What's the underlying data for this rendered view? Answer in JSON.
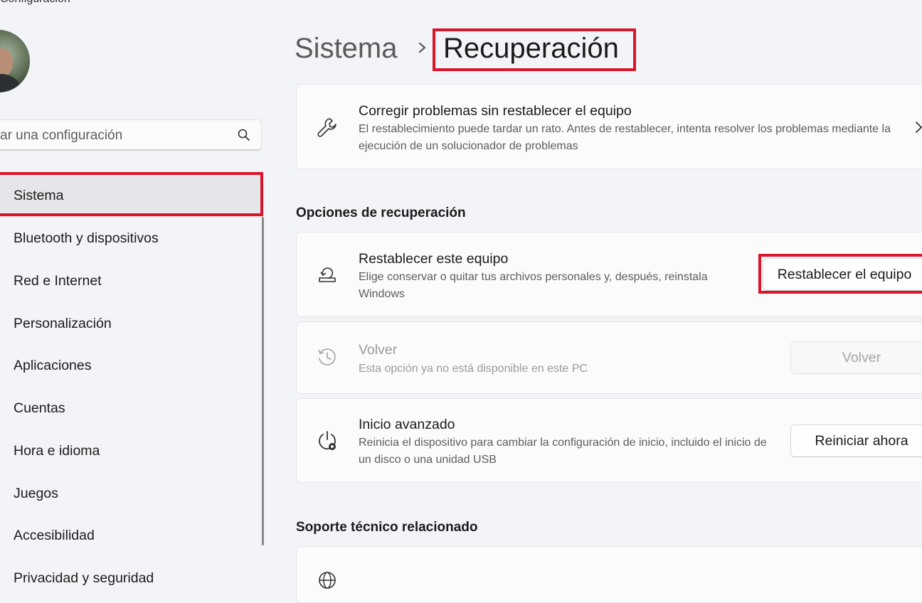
{
  "window": {
    "app_title": "Configuración"
  },
  "search": {
    "placeholder": "Buscar una configuración",
    "visible_text": "scar una configuración",
    "icon": "search-icon"
  },
  "sidebar": {
    "items": [
      {
        "label": "Sistema",
        "active": true
      },
      {
        "label": "Bluetooth y dispositivos"
      },
      {
        "label": "Red e Internet"
      },
      {
        "label": "Personalización"
      },
      {
        "label": "Aplicaciones"
      },
      {
        "label": "Cuentas"
      },
      {
        "label": "Hora e idioma"
      },
      {
        "label": "Juegos"
      },
      {
        "label": "Accesibilidad"
      },
      {
        "label": "Privacidad y seguridad"
      }
    ]
  },
  "breadcrumb": {
    "parent": "Sistema",
    "current": "Recuperación"
  },
  "fix_card": {
    "title": "Corregir problemas sin restablecer el equipo",
    "desc": "El restablecimiento puede tardar un rato. Antes de restablecer, intenta resolver los problemas mediante la ejecución de un solucionador de problemas",
    "icon": "wrench-icon"
  },
  "recovery_section": {
    "title": "Opciones de recuperación",
    "reset": {
      "title": "Restablecer este equipo",
      "desc": "Elige conservar o quitar tus archivos personales y, después, reinstala Windows",
      "button": "Restablecer el equipo",
      "icon": "reset-pc-icon"
    },
    "goback": {
      "title": "Volver",
      "desc": "Esta opción ya no está disponible en este PC",
      "button": "Volver",
      "icon": "history-icon"
    },
    "advanced": {
      "title": "Inicio avanzado",
      "desc": "Reinicia el dispositivo para cambiar la configuración de inicio, incluido el inicio de un disco o una unidad USB",
      "button": "Reiniciar ahora",
      "icon": "power-settings-icon"
    }
  },
  "support_section": {
    "title": "Soporte técnico relacionado",
    "icon": "globe-icon"
  },
  "colors": {
    "highlight": "#d9162a",
    "background": "#f2f4f8",
    "card": "#fbfbfc"
  }
}
